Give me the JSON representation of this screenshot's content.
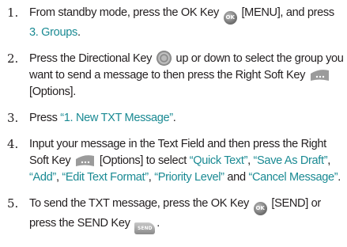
{
  "steps": [
    {
      "num": "1.",
      "t1": "From standby mode, press the OK Key",
      "ok_icon_text": "OK",
      "t2": "[MENU], and press",
      "link1": "3. Groups",
      "t3": "."
    },
    {
      "num": "2.",
      "t1": "Press the Directional Key",
      "t2": "up or down to select the group you want to send a message to then press the Right Soft Key",
      "t3": "[Options]."
    },
    {
      "num": "3.",
      "t1": "Press",
      "link1": "“1. New TXT Message”",
      "t2": "."
    },
    {
      "num": "4.",
      "t1": "Input your message in the Text Field and then press the Right Soft Key",
      "t2": "[Options] to select",
      "link1": "“Quick Text”",
      "sep1": ",",
      "link2": "“Save As Draft”",
      "sep2": ",",
      "link3": "“Add”",
      "sep3": ",",
      "link4": "“Edit Text Format”",
      "sep4": ",",
      "link5": "“Priority Level”",
      "and": "and",
      "link6": "“Cancel Message”",
      "end": "."
    },
    {
      "num": "5.",
      "t1": "To send the TXT message, press the OK Key",
      "ok_icon_text": "OK",
      "t2": "[SEND] or press the SEND Key",
      "send_icon_text": "SEND",
      "t3": "."
    }
  ],
  "icons": {
    "ok_key": "ok-key-icon",
    "directional_key": "directional-key-icon",
    "right_soft_key": "right-soft-key-icon",
    "send_key": "send-key-icon"
  },
  "colors": {
    "text": "#231f20",
    "highlight": "#1a8a93"
  }
}
